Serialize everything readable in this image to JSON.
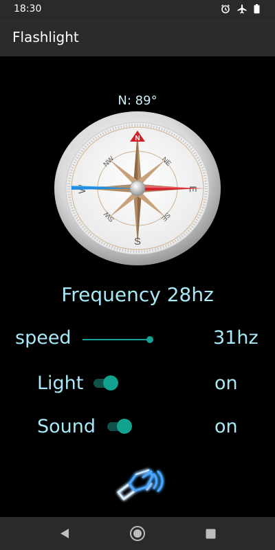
{
  "status_bar": {
    "time": "18:30",
    "icons": [
      "alarm-icon",
      "airplane-icon",
      "battery-icon"
    ]
  },
  "app_bar": {
    "title": "Flashlight"
  },
  "compass": {
    "heading_label": "N: 89°",
    "directions": {
      "n": "N",
      "ne": "NE",
      "e": "E",
      "se": "SE",
      "s": "S",
      "sw": "SW",
      "w": "W",
      "nw": "NW"
    }
  },
  "frequency": {
    "label": "Frequency 28hz"
  },
  "controls": {
    "speed": {
      "label": "speed",
      "value": "31hz",
      "level": 0.95
    },
    "light": {
      "label": "Light",
      "state": "on",
      "enabled": true
    },
    "sound": {
      "label": "Sound",
      "state": "on",
      "enabled": true
    }
  },
  "flash_button": {
    "icon": "flashlight-glow-icon",
    "color": "#3ea0ff"
  },
  "nav_bar": {
    "buttons": [
      "back-icon",
      "home-icon",
      "recents-icon"
    ]
  },
  "colors": {
    "accent_text": "#a9e9f7",
    "switch_on": "#12a08f",
    "status_bar": "#2a2a2a"
  }
}
